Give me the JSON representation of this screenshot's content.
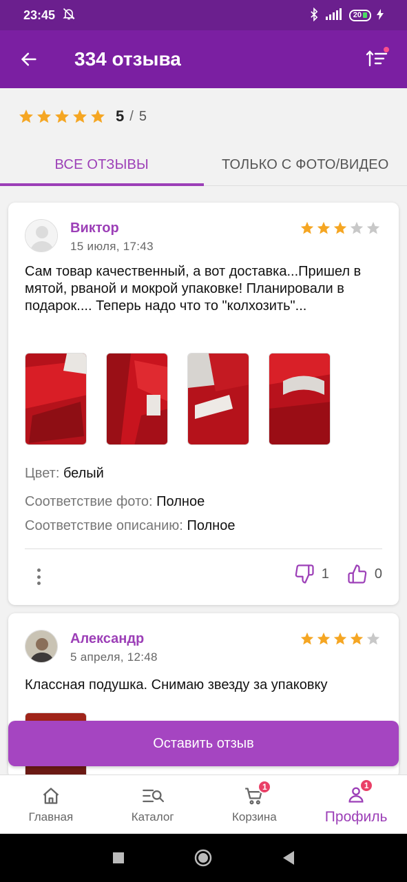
{
  "status_bar": {
    "time": "23:45",
    "battery": "20"
  },
  "app_bar": {
    "title": "334 отзыва"
  },
  "summary": {
    "rating": "5",
    "separator": "/",
    "max": "5",
    "stars_filled": 5
  },
  "tabs": [
    {
      "label": "ВСЕ ОТЗЫВЫ",
      "active": true
    },
    {
      "label": "ТОЛЬКО С ФОТО/ВИДЕО",
      "active": false
    }
  ],
  "reviews": [
    {
      "author": "Виктор",
      "date": "15 июля, 17:43",
      "stars": 3,
      "text": "Сам товар качественный, а вот доставка...Пришел в мятой, рваной и мокрой упаковке! Планировали в подарок.... Теперь надо что то \"колхозить\"...",
      "photos_count": 4,
      "color_label": "Цвет:",
      "color_value": "белый",
      "photo_match_label": "Соответствие фото:",
      "photo_match_value": "Полное",
      "desc_match_label": "Соответствие описанию:",
      "desc_match_value": "Полное",
      "dislikes": "1",
      "likes": "0"
    },
    {
      "author": "Александр",
      "date": "5 апреля, 12:48",
      "stars": 4,
      "text": "Классная подушка. Снимаю звезду за упаковку"
    }
  ],
  "leave_review": {
    "label": "Оставить отзыв"
  },
  "bottom_nav": [
    {
      "label": "Главная",
      "icon": "home-icon"
    },
    {
      "label": "Каталог",
      "icon": "catalog-search-icon"
    },
    {
      "label": "Корзина",
      "icon": "cart-icon",
      "badge": "1"
    },
    {
      "label": "Профиль",
      "icon": "profile-icon",
      "badge": "1",
      "active": true
    }
  ],
  "colors": {
    "primary": "#7b1fa2",
    "status_bar": "#6b1f8e",
    "accent": "#9c3fb7",
    "star": "#f5a623",
    "star_empty": "#c8c8c8",
    "badge": "#e94067"
  }
}
